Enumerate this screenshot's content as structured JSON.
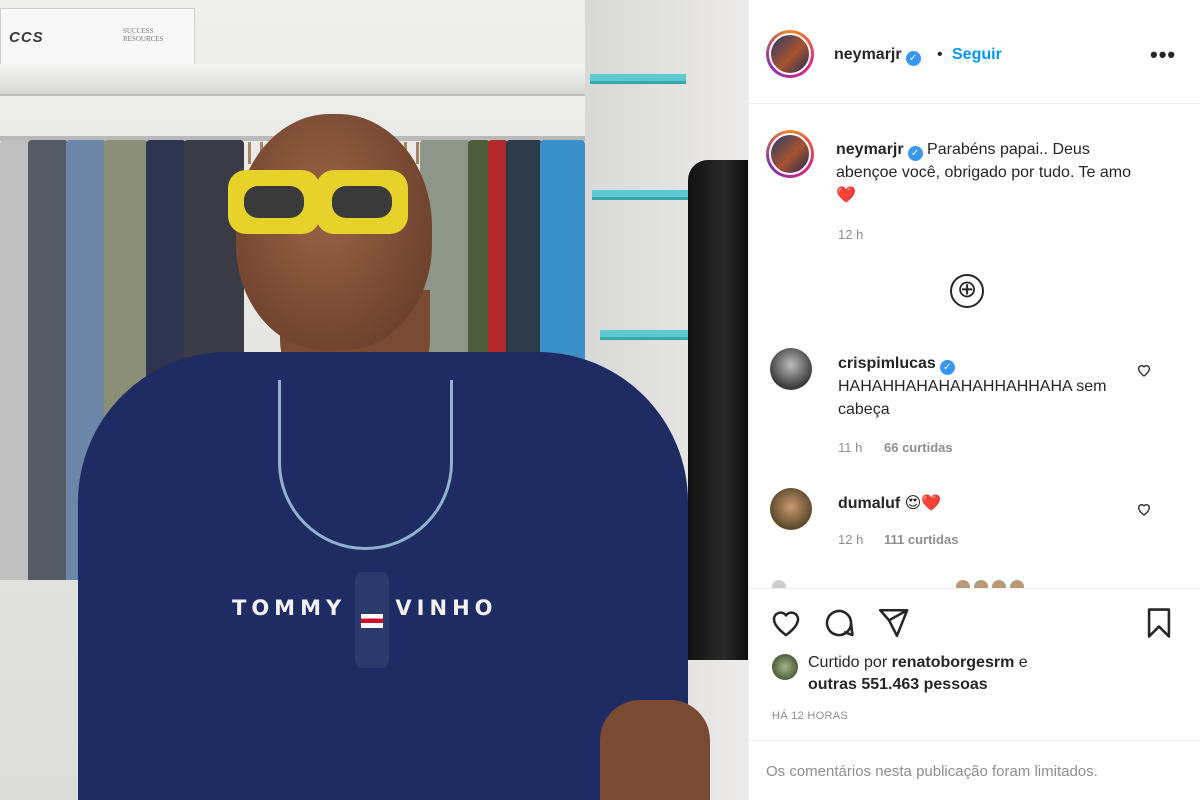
{
  "post": {
    "owner": "neymarjr",
    "follow_label": "Seguir",
    "more_label": "•••",
    "dot": "•"
  },
  "photo": {
    "box_logo": "CCS",
    "box_text": "SUCCESS RESOURCES",
    "shirt_text": "TOMMY    VINHO"
  },
  "caption": {
    "username": "neymarjr",
    "text": "Parabéns papai.. Deus abençoe você, obrigado por tudo. Te amo ❤️",
    "time": "12 h"
  },
  "load_more": "⊕",
  "comments": [
    {
      "username": "crispimlucas",
      "verified": true,
      "text": "HAHAHHAHAHAHAHHAHHAHA sem cabeça",
      "time": "11 h",
      "likes": "66 curtidas"
    },
    {
      "username": "dumaluf",
      "verified": false,
      "text": "😍❤️",
      "time": "12 h",
      "likes": "111 curtidas"
    }
  ],
  "liked": {
    "prefix": "Curtido por",
    "user": "renatoborgesrm",
    "joiner": "e",
    "others": "outras 551.463 pessoas"
  },
  "timestamp": "HÁ 12 HORAS",
  "comments_limited": "Os comentários nesta publicação foram limitados.",
  "colors": {
    "accent": "#0095f6",
    "verified": "#3897f0",
    "heart": "#ed4956",
    "muted": "#8e8e8e"
  }
}
